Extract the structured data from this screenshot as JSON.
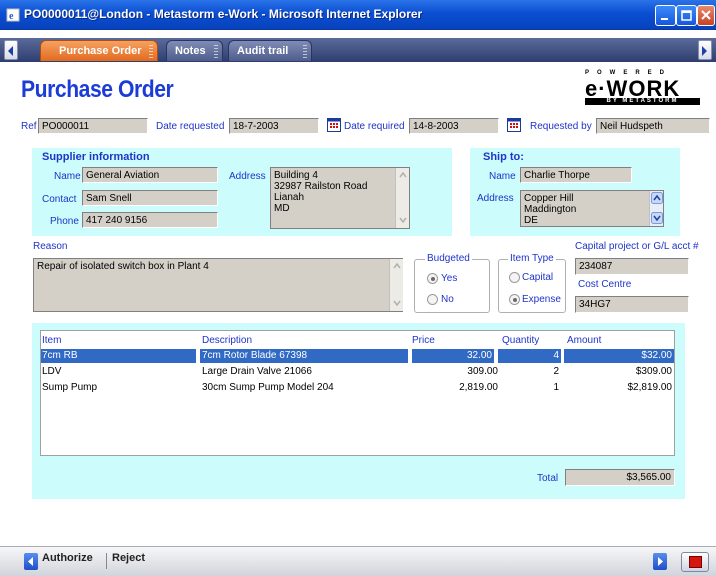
{
  "window": {
    "title": "PO0000011@London - Metastorm e-Work - Microsoft Internet Explorer"
  },
  "tabs": [
    {
      "label": "Purchase Order",
      "active": true
    },
    {
      "label": "Notes",
      "active": false
    },
    {
      "label": "Audit trail",
      "active": false
    }
  ],
  "page": {
    "title": "Purchase Order"
  },
  "logo": {
    "top": "POWERED",
    "main": "e·WORK",
    "bottom": "BY METASTORM"
  },
  "header": {
    "ref_label": "Ref",
    "ref_value": "PO000011",
    "date_requested_label": "Date requested",
    "date_requested_value": "18-7-2003",
    "date_required_label": "Date required",
    "date_required_value": "14-8-2003",
    "requested_by_label": "Requested by",
    "requested_by_value": "Neil Hudspeth"
  },
  "supplier": {
    "section_title": "Supplier information",
    "name_label": "Name",
    "name_value": "General Aviation",
    "contact_label": "Contact",
    "contact_value": "Sam Snell",
    "phone_label": "Phone",
    "phone_value": "417 240 9156",
    "address_label": "Address",
    "address_lines": [
      "Building 4",
      "32987 Railston Road",
      "Lianah",
      "MD"
    ]
  },
  "ship_to": {
    "section_title": "Ship to:",
    "name_label": "Name",
    "name_value": "Charlie Thorpe",
    "address_label": "Address",
    "address_lines": [
      "Copper Hill",
      "Maddington",
      "DE"
    ]
  },
  "reason": {
    "label": "Reason",
    "value": "Repair of isolated switch box in Plant 4"
  },
  "budgeted": {
    "label": "Budgeted",
    "options": [
      "Yes",
      "No"
    ],
    "selected": "Yes"
  },
  "item_type": {
    "label": "Item Type",
    "options": [
      "Capital",
      "Expense"
    ],
    "selected": "Expense"
  },
  "capital": {
    "label": "Capital project or G/L acct #",
    "value": "234087",
    "cost_centre_label": "Cost Centre",
    "cost_centre_value": "34HG7"
  },
  "items": {
    "columns": [
      "Item",
      "Description",
      "Price",
      "Quantity",
      "Amount"
    ],
    "rows": [
      {
        "item": "7cm RB",
        "description": "7cm Rotor Blade 67398",
        "price": "32.00",
        "quantity": "4",
        "amount": "$32.00",
        "selected": true
      },
      {
        "item": "LDV",
        "description": "Large Drain Valve 21066",
        "price": "309.00",
        "quantity": "2",
        "amount": "$309.00",
        "selected": false
      },
      {
        "item": "Sump Pump",
        "description": "30cm Sump Pump Model 204",
        "price": "2,819.00",
        "quantity": "1",
        "amount": "$2,819.00",
        "selected": false
      }
    ],
    "total_label": "Total",
    "total_value": "$3,565.00"
  },
  "actions": {
    "authorize_label": "Authorize",
    "reject_label": "Reject"
  },
  "colors": {
    "label_blue": "#1f34c8",
    "title_blue": "#1b3cd8",
    "panel_cyan": "#ccfcfc",
    "selection_blue": "#316ac5",
    "active_tab_orange": "#e36a1f"
  }
}
